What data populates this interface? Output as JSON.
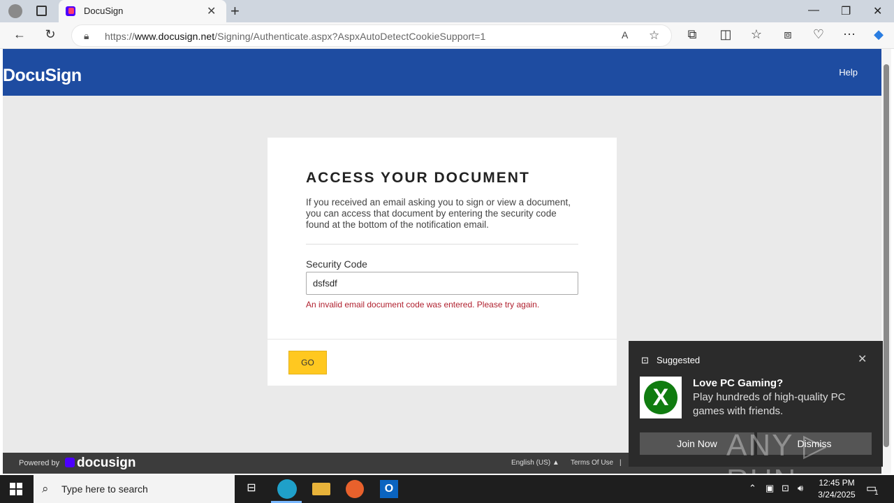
{
  "browser": {
    "tab_title": "DocuSign",
    "url_prefix": "https://",
    "url_domain": "www.docusign.net",
    "url_path": "/Signing/Authenticate.aspx?AspxAutoDetectCookieSupport=1"
  },
  "header": {
    "logo": "DocuSign",
    "help_label": "Help"
  },
  "card": {
    "title": "ACCESS YOUR DOCUMENT",
    "description": "If you received an email asking you to sign or view a document, you can access that document by entering the security code found at the bottom of the notification email.",
    "security_label": "Security Code",
    "security_value": "dsfsdf",
    "error": "An invalid email document code was entered. Please try again.",
    "go_label": "GO"
  },
  "footer": {
    "powered_by": "Powered by",
    "brand": "docusign",
    "language": "English (US) ▲",
    "terms": "Terms Of Use",
    "separator": "|"
  },
  "toast": {
    "header": "Suggested",
    "title": "Love PC Gaming?",
    "body": "Play hundreds of high-quality PC games with friends.",
    "primary_button": "Join Now",
    "secondary_button": "Dismiss"
  },
  "watermark": "ANY ▷ RUN",
  "taskbar": {
    "search_placeholder": "Type here to search",
    "time": "12:45 PM",
    "date": "3/24/2025",
    "notification_count": "1"
  }
}
